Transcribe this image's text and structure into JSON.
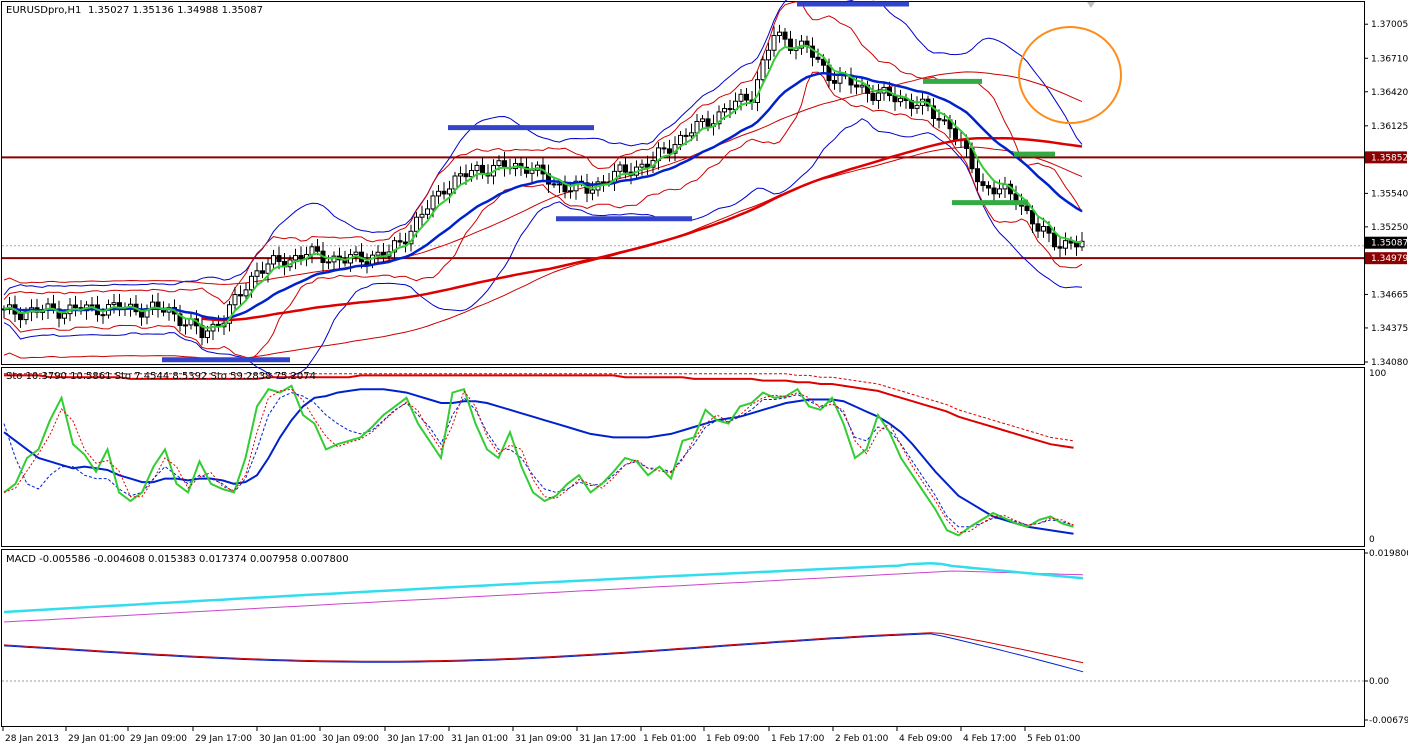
{
  "colors": {
    "up_candle": "#ffffff",
    "down_candle": "#000000",
    "bollinger_outer": "#0000cc",
    "envelope": "#cc0000",
    "ma_green": "#33cc33",
    "ma_blue": "#0022cc",
    "ma_red": "#dd0000",
    "level_line": "#8b0000",
    "marker_blue": "#3344cc",
    "marker_green": "#33aa44",
    "circle": "#ff8c1a",
    "macd_main": "#33ddee",
    "macd_signal": "#cc44cc",
    "osma_blue": "#0022cc",
    "osma_red": "#cc0000"
  },
  "chart_data": {
    "type": "candlestick",
    "symbol_header": {
      "symbol": "EURUSDpro,H1",
      "ohlc": "1.35027 1.35136 1.34988 1.35087"
    },
    "price_axis": {
      "min": 1.3408,
      "max": 1.3718,
      "ticks": [
        "1.37005",
        "1.36710",
        "1.36420",
        "1.36125",
        "1.35540",
        "1.35250",
        "1.34665",
        "1.34375",
        "1.34080"
      ]
    },
    "levels": [
      {
        "price": 1.35852,
        "label": "1.35852"
      },
      {
        "price": 1.34979,
        "label": "1.34979"
      }
    ],
    "current_price": {
      "price": 1.35087,
      "label": "1.35087"
    },
    "time_axis_labels": [
      "28 Jan 2013",
      "29 Jan 01:00",
      "29 Jan 09:00",
      "29 Jan 17:00",
      "30 Jan 01:00",
      "30 Jan 09:00",
      "30 Jan 17:00",
      "31 Jan 01:00",
      "31 Jan 09:00",
      "31 Jan 17:00",
      "1 Feb 01:00",
      "1 Feb 09:00",
      "1 Feb 17:00",
      "2 Feb 01:00",
      "4 Feb 09:00",
      "4 Feb 17:00",
      "5 Feb 01:00"
    ],
    "close_waypoints": [
      [
        0,
        1.3451
      ],
      [
        20,
        1.3455
      ],
      [
        30,
        1.3453
      ],
      [
        36,
        1.3432
      ],
      [
        40,
        1.3446
      ],
      [
        46,
        1.3488
      ],
      [
        55,
        1.3502
      ],
      [
        62,
        1.3496
      ],
      [
        70,
        1.3502
      ],
      [
        74,
        1.3523
      ],
      [
        80,
        1.356
      ],
      [
        86,
        1.3575
      ],
      [
        95,
        1.3578
      ],
      [
        100,
        1.3562
      ],
      [
        106,
        1.3557
      ],
      [
        110,
        1.3568
      ],
      [
        118,
        1.3582
      ],
      [
        122,
        1.3599
      ],
      [
        128,
        1.3617
      ],
      [
        136,
        1.364
      ],
      [
        140,
        1.3691
      ],
      [
        146,
        1.3679
      ],
      [
        150,
        1.3657
      ],
      [
        158,
        1.3641
      ],
      [
        166,
        1.3632
      ],
      [
        172,
        1.3613
      ],
      [
        178,
        1.356
      ],
      [
        184,
        1.3552
      ],
      [
        188,
        1.3522
      ],
      [
        192,
        1.3511
      ],
      [
        196,
        1.3509
      ]
    ],
    "markers": [
      {
        "color": "blue",
        "price": 1.3718,
        "x1": 797,
        "x2": 909
      },
      {
        "color": "blue",
        "price": 1.3611,
        "x1": 448,
        "x2": 594
      },
      {
        "color": "blue",
        "price": 1.3532,
        "x1": 556,
        "x2": 692
      },
      {
        "color": "blue",
        "price": 1.341,
        "x1": 162,
        "x2": 290
      },
      {
        "color": "green",
        "price": 1.3651,
        "x1": 923,
        "x2": 982
      },
      {
        "color": "green",
        "price": 1.3588,
        "x1": 1014,
        "x2": 1055
      },
      {
        "color": "green",
        "price": 1.3546,
        "x1": 952,
        "x2": 1028
      }
    ],
    "stochastic": {
      "header": "Sto 10.3790 10.5861  Sto 7.4544 8.5392  Sto 59.2838 75.2074",
      "ylim": [
        0,
        100
      ],
      "ticks": [
        "100",
        "0"
      ],
      "fast": [
        30,
        35,
        50,
        55,
        72,
        85,
        58,
        52,
        42,
        55,
        30,
        25,
        30,
        45,
        55,
        35,
        30,
        48,
        35,
        32,
        30,
        50,
        80,
        90,
        88,
        92,
        75,
        70,
        55,
        58,
        60,
        62,
        68,
        75,
        80,
        85,
        70,
        60,
        50,
        88,
        90,
        70,
        55,
        50,
        65,
        45,
        30,
        25,
        28,
        35,
        40,
        30,
        35,
        42,
        50,
        48,
        40,
        45,
        38,
        60,
        62,
        78,
        72,
        70,
        80,
        82,
        88,
        85,
        86,
        90,
        80,
        78,
        85,
        70,
        50,
        55,
        75,
        65,
        50,
        40,
        30,
        20,
        8,
        5,
        10,
        14,
        18,
        15,
        12,
        10,
        14,
        16,
        12,
        10
      ],
      "slow": [
        70,
        50,
        35,
        32,
        40,
        45,
        45,
        40,
        38,
        38,
        32,
        28,
        30,
        38,
        45,
        40,
        35,
        40,
        38,
        35,
        30,
        38,
        55,
        75,
        85,
        88,
        86,
        82,
        75,
        70,
        66,
        64,
        66,
        72,
        78,
        82,
        75,
        68,
        58,
        75,
        85,
        78,
        65,
        55,
        55,
        50,
        40,
        32,
        30,
        32,
        36,
        34,
        35,
        40,
        46,
        48,
        44,
        44,
        42,
        50,
        58,
        68,
        72,
        71,
        74,
        78,
        84,
        84,
        85,
        87,
        83,
        80,
        83,
        76,
        62,
        60,
        68,
        66,
        58,
        48,
        38,
        28,
        16,
        10,
        10,
        12,
        15,
        15,
        13,
        11,
        12,
        14,
        13,
        11
      ],
      "mid": [
        65,
        60,
        55,
        50,
        48,
        46,
        44,
        45,
        44,
        43,
        40,
        38,
        36,
        36,
        38,
        38,
        37,
        38,
        38,
        37,
        35,
        36,
        40,
        50,
        62,
        72,
        80,
        85,
        86,
        88,
        89,
        90,
        90,
        90,
        89,
        88,
        86,
        84,
        82,
        82,
        83,
        83,
        82,
        80,
        78,
        76,
        74,
        72,
        70,
        68,
        66,
        64,
        63,
        62,
        62,
        62,
        62,
        63,
        64,
        66,
        68,
        70,
        72,
        73,
        74,
        76,
        78,
        80,
        82,
        83,
        84,
        84,
        84,
        83,
        80,
        77,
        74,
        70,
        65,
        58,
        50,
        42,
        35,
        28,
        24,
        20,
        16,
        14,
        12,
        10,
        9,
        8,
        7,
        6
      ],
      "slow_red": [
        98,
        98,
        98,
        98,
        97,
        97,
        97,
        97,
        97,
        97,
        97,
        96,
        96,
        96,
        96,
        96,
        96,
        96,
        96,
        96,
        96,
        96,
        96,
        97,
        97,
        97,
        97,
        97,
        97,
        97,
        97,
        98,
        98,
        98,
        98,
        98,
        98,
        98,
        98,
        98,
        98,
        98,
        98,
        98,
        98,
        98,
        98,
        98,
        98,
        98,
        98,
        98,
        98,
        98,
        97,
        97,
        97,
        97,
        97,
        97,
        96,
        96,
        96,
        96,
        96,
        96,
        95,
        95,
        95,
        94,
        94,
        93,
        93,
        92,
        91,
        90,
        89,
        87,
        85,
        83,
        81,
        79,
        77,
        74,
        72,
        70,
        68,
        66,
        64,
        62,
        60,
        58,
        57,
        56
      ]
    },
    "macd": {
      "header": "MACD -0.005586 -0.004608 0.015383 0.017374 0.007958 0.007800",
      "ticks": [
        "0.019800",
        "0.00",
        "-0.006790"
      ]
    }
  }
}
